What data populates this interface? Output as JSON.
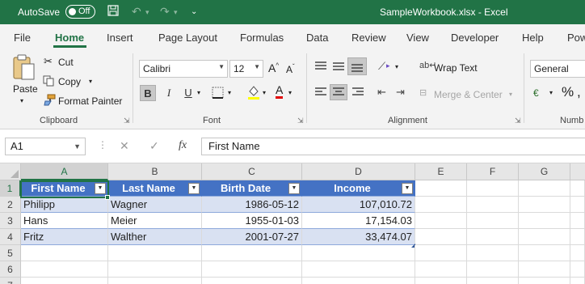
{
  "titlebar": {
    "autosave_label": "AutoSave",
    "autosave_state": "Off",
    "document_title": "SampleWorkbook.xlsx  -  Excel"
  },
  "tabs": [
    "File",
    "Home",
    "Insert",
    "Page Layout",
    "Formulas",
    "Data",
    "Review",
    "View",
    "Developer",
    "Help",
    "Pow"
  ],
  "ribbon": {
    "clipboard": {
      "paste": "Paste",
      "cut": "Cut",
      "copy": "Copy",
      "format_painter": "Format Painter",
      "label": "Clipboard"
    },
    "font": {
      "family": "Calibri",
      "size": "12",
      "bold": "B",
      "italic": "I",
      "underline": "U",
      "grow": "A",
      "shrink": "A",
      "font_color": "A",
      "label": "Font"
    },
    "alignment": {
      "wrap_text": "Wrap Text",
      "merge_center": "Merge & Center",
      "label": "Alignment"
    },
    "number": {
      "format": "General",
      "percent": "%",
      "label": "Numb"
    }
  },
  "formula_bar": {
    "name_box": "A1",
    "fx": "fx",
    "content": "First Name"
  },
  "grid": {
    "columns": [
      "A",
      "B",
      "C",
      "D",
      "E",
      "F",
      "G"
    ],
    "rows": [
      "1",
      "2",
      "3",
      "4",
      "5",
      "6",
      "7"
    ],
    "headers": [
      "First Name",
      "Last Name",
      "Birth Date",
      "Income"
    ],
    "data": [
      [
        "Philipp",
        "Wagner",
        "1986-05-12",
        "107,010.72"
      ],
      [
        "Hans",
        "Meier",
        "1955-01-03",
        "17,154.03"
      ],
      [
        "Fritz",
        "Walther",
        "2001-07-27",
        "33,474.07"
      ]
    ]
  },
  "colors": {
    "excel_green": "#217346",
    "table_header": "#4472c4",
    "table_band": "#d9e1f2"
  }
}
